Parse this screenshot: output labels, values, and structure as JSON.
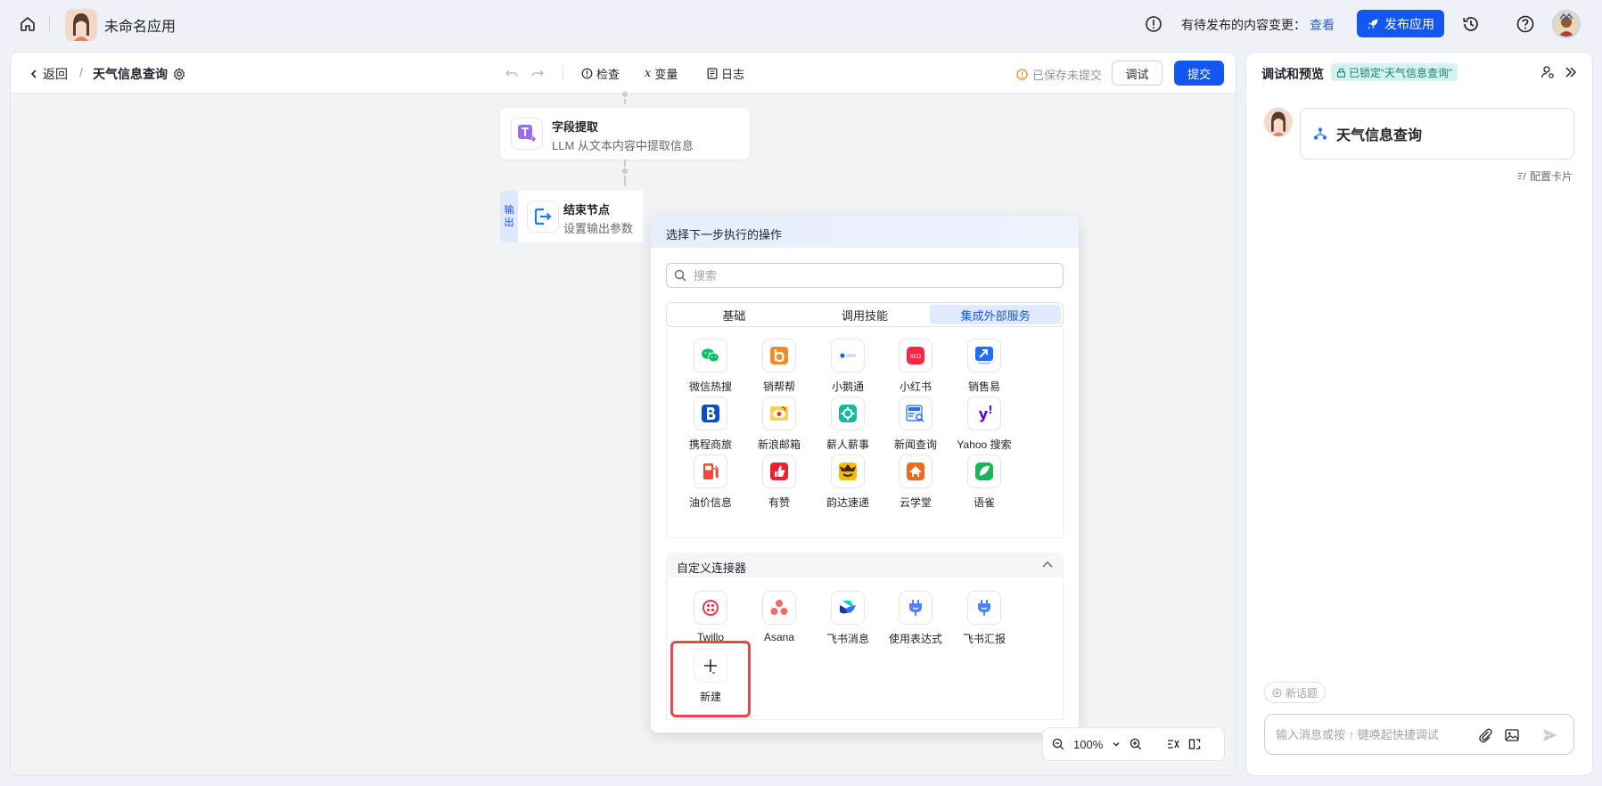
{
  "topbar": {
    "app_name": "未命名应用",
    "pending_text": "有待发布的内容变更：",
    "pending_link": "查看",
    "publish_label": "发布应用"
  },
  "canvas_header": {
    "back_label": "返回",
    "separator": "/",
    "flow_title": "天气信息查询",
    "tools": [
      {
        "label": "检查",
        "icon": "info-circle-icon"
      },
      {
        "label": "变量",
        "icon": "variable-icon"
      },
      {
        "label": "日志",
        "icon": "log-icon"
      }
    ],
    "saved_status": "已保存未提交",
    "debug_label": "调试",
    "submit_label": "提交"
  },
  "nodes": {
    "extract": {
      "title": "字段提取",
      "subtitle": "LLM 从文本内容中提取信息"
    },
    "end": {
      "title": "结束节点",
      "subtitle": "设置输出参数",
      "side_tag": [
        "输",
        "出"
      ]
    }
  },
  "popup": {
    "title": "选择下一步执行的操作",
    "search_placeholder": "搜索",
    "tabs": [
      "基础",
      "调用技能",
      "集成外部服务"
    ],
    "active_tab": 2,
    "services": [
      {
        "label": "微信热搜",
        "icon": "wechat-icon",
        "color": "#07c160"
      },
      {
        "label": "销帮帮",
        "icon": "xiaobangbang-icon",
        "color": "#f08a24"
      },
      {
        "label": "小鹅通",
        "icon": "xiaoetong-icon",
        "color": "#2b5cf0"
      },
      {
        "label": "小红书",
        "icon": "xiaohongshu-icon",
        "color": "#ff2442"
      },
      {
        "label": "销售易",
        "icon": "xiaoshouyi-icon",
        "color": "#1e6ff2"
      },
      {
        "label": "携程商旅",
        "icon": "ctrip-icon",
        "color": "#0a4fbf"
      },
      {
        "label": "新浪邮箱",
        "icon": "sina-mail-icon",
        "color": "#e8322d"
      },
      {
        "label": "薪人薪事",
        "icon": "xinrenxinshi-icon",
        "color": "#14b89c"
      },
      {
        "label": "新闻查询",
        "icon": "news-icon",
        "color": "#2b6de8"
      },
      {
        "label": "Yahoo 搜索",
        "icon": "yahoo-icon",
        "color": "#6001d2"
      },
      {
        "label": "油价信息",
        "icon": "fuel-icon",
        "color": "#f0483c"
      },
      {
        "label": "有赞",
        "icon": "youzan-icon",
        "color": "#e8222e"
      },
      {
        "label": "韵达速递",
        "icon": "yunda-icon",
        "color": "#f6b800"
      },
      {
        "label": "云学堂",
        "icon": "yunxuetang-icon",
        "color": "#f06a1e"
      },
      {
        "label": "语雀",
        "icon": "yuque-icon",
        "color": "#1cb45a"
      }
    ],
    "custom_section_title": "自定义连接器",
    "custom_connectors": [
      {
        "label": "Twillo",
        "icon": "twilio-icon",
        "color": "#e5364a"
      },
      {
        "label": "Asana",
        "icon": "asana-icon",
        "color": "#f06a6a"
      },
      {
        "label": "飞书消息",
        "icon": "feishu-icon",
        "color": "#3370ff"
      },
      {
        "label": "使用表达式",
        "icon": "plug-icon",
        "color": "#4e83fd"
      },
      {
        "label": "飞书汇报",
        "icon": "plug-icon",
        "color": "#4e83fd"
      }
    ],
    "new_label": "新建"
  },
  "zoom": {
    "level": "100%"
  },
  "right_panel": {
    "title": "调试和预览",
    "lock_badge": "已锁定“天气信息查询”",
    "card_title": "天气信息查询",
    "config_card": "配置卡片",
    "new_topic": "新话题",
    "input_placeholder": "输入消息或按 ↑ 键唤起快捷调试"
  }
}
